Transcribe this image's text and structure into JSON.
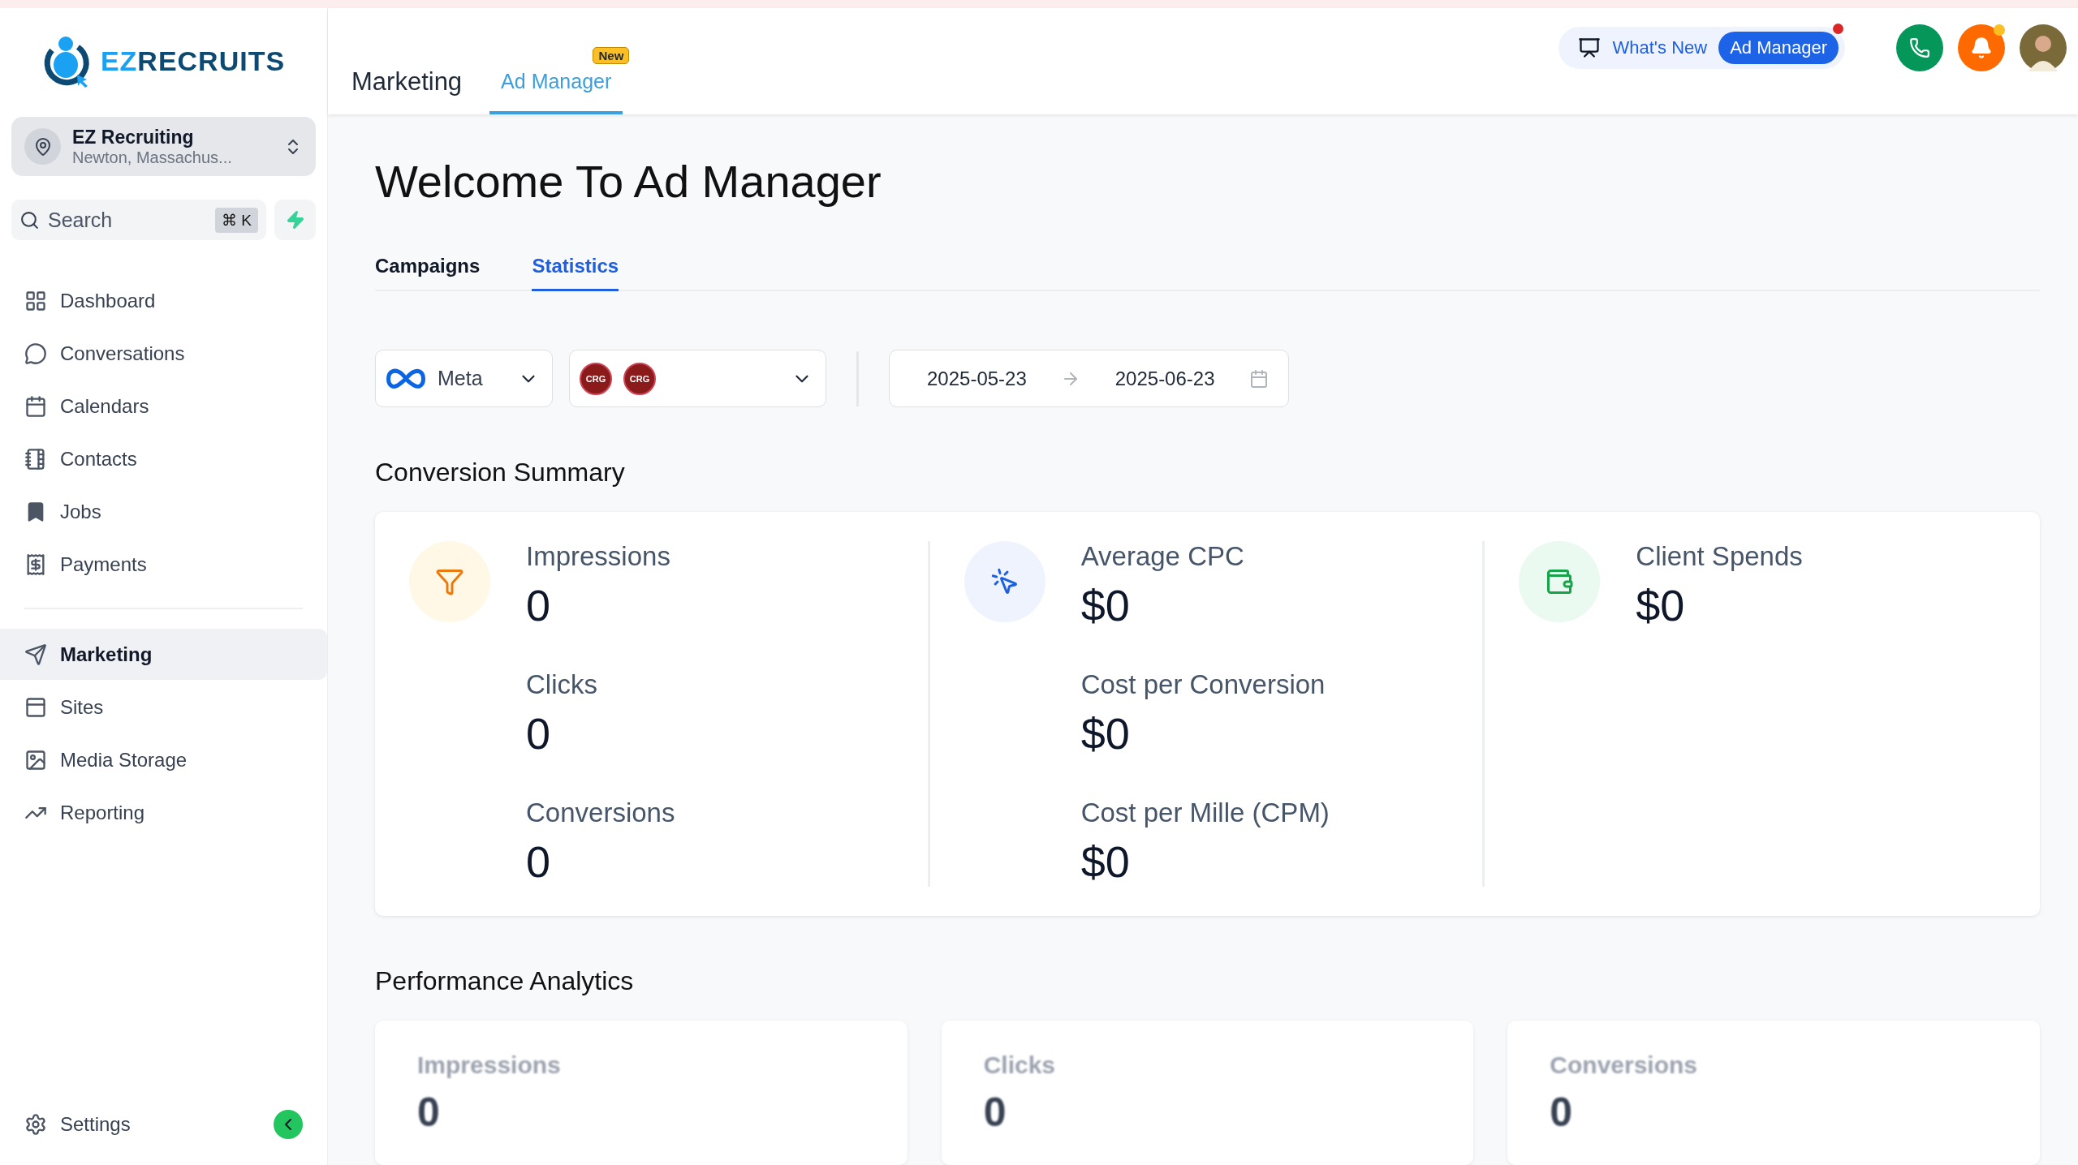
{
  "sidebar": {
    "logo": {
      "part_1": "EZ",
      "part_2": "RECRUITS"
    },
    "location": {
      "name": "EZ Recruiting",
      "address": "Newton, Massachus..."
    },
    "search": {
      "placeholder": "Search",
      "shortcut": "⌘ K"
    },
    "items": [
      {
        "label": "Dashboard",
        "selected": false
      },
      {
        "label": "Conversations",
        "selected": false
      },
      {
        "label": "Calendars",
        "selected": false
      },
      {
        "label": "Contacts",
        "selected": false
      },
      {
        "label": "Jobs",
        "selected": false
      },
      {
        "label": "Payments",
        "selected": false
      }
    ],
    "items_2": [
      {
        "label": "Marketing",
        "selected": true
      },
      {
        "label": "Sites",
        "selected": false
      },
      {
        "label": "Media Storage",
        "selected": false
      },
      {
        "label": "Reporting",
        "selected": false
      }
    ],
    "settings": "Settings"
  },
  "header": {
    "title": "Marketing",
    "tabs": [
      {
        "label": "Ad Manager",
        "badge": "New",
        "selected": true
      }
    ],
    "whats_new": "What's New",
    "whats_new_tag": "Ad Manager"
  },
  "page": {
    "title": "Welcome To Ad Manager",
    "tabs": [
      {
        "label": "Campaigns",
        "selected": false
      },
      {
        "label": "Statistics",
        "selected": true
      }
    ],
    "platform": "Meta",
    "accounts": [
      "CRG",
      "CRG"
    ],
    "date_start": "2025-05-23",
    "date_end": "2025-06-23",
    "summary_title": "Conversion Summary",
    "summary": [
      {
        "metrics": [
          {
            "label": "Impressions",
            "value": "0"
          },
          {
            "label": "Clicks",
            "value": "0"
          },
          {
            "label": "Conversions",
            "value": "0"
          }
        ]
      },
      {
        "metrics": [
          {
            "label": "Average CPC",
            "value": "$0"
          },
          {
            "label": "Cost per Conversion",
            "value": "$0"
          },
          {
            "label": "Cost per Mille (CPM)",
            "value": "$0"
          }
        ]
      },
      {
        "metrics": [
          {
            "label": "Client Spends",
            "value": "$0"
          }
        ]
      }
    ],
    "analytics_title": "Performance Analytics",
    "analytics": [
      {
        "label": "Impressions",
        "value": "0"
      },
      {
        "label": "Clicks",
        "value": "0"
      },
      {
        "label": "Conversions",
        "value": "0"
      }
    ]
  }
}
